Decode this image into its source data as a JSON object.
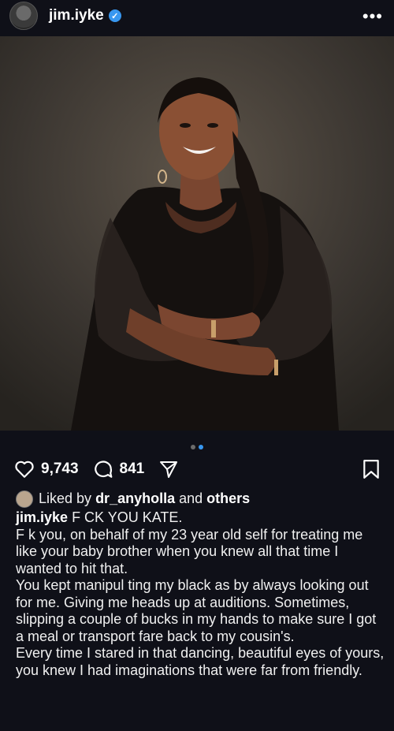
{
  "header": {
    "username": "jim.iyke",
    "more": "•••"
  },
  "colors": {
    "background": "#0f1018",
    "accent": "#3897f0"
  },
  "carousel": {
    "active_index": 1,
    "count": 2
  },
  "actions": {
    "likes": "9,743",
    "comments": "841"
  },
  "icons": [
    "heart-icon",
    "comment-icon",
    "share-icon",
    "bookmark-icon"
  ],
  "caption": {
    "liked_prefix": "Liked by",
    "liked_user": "dr_anyholla",
    "liked_and": "and",
    "liked_others": "others",
    "author": "jim.iyke",
    "headline": "F  CK YOU KATE.",
    "paragraphs": [
      "F  k you, on behalf of my 23 year old self for treating me like your baby brother when you knew all that time I wanted to hit that.",
      "You kept manipul  ting my black as  by always looking out for me. Giving me heads up at auditions. Sometimes, slipping a couple of bucks in my hands to make sure I got a meal or transport fare back to my cousin's.",
      "Every time I stared in that dancing, beautiful eyes of yours, you knew I had imaginations that were far from friendly."
    ]
  }
}
